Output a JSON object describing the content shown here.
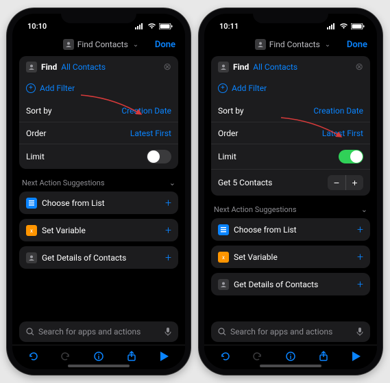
{
  "phones": [
    {
      "time": "10:10",
      "nav": {
        "title": "Find Contacts",
        "done": "Done"
      },
      "find": {
        "action": "Find",
        "target": "All Contacts",
        "add_filter": "Add Filter"
      },
      "sort": {
        "label": "Sort by",
        "value": "Creation Date"
      },
      "order": {
        "label": "Order",
        "value": "Latest First"
      },
      "limit": {
        "label": "Limit",
        "on": false
      },
      "get_row": null,
      "suggestions_header": "Next Action Suggestions",
      "suggestions": [
        {
          "label": "Choose from List",
          "icon": "blue"
        },
        {
          "label": "Set Variable",
          "icon": "orange"
        },
        {
          "label": "Get Details of Contacts",
          "icon": "gray"
        }
      ],
      "search_placeholder": "Search for apps and actions"
    },
    {
      "time": "10:11",
      "nav": {
        "title": "Find Contacts",
        "done": "Done"
      },
      "find": {
        "action": "Find",
        "target": "All Contacts",
        "add_filter": "Add Filter"
      },
      "sort": {
        "label": "Sort by",
        "value": "Creation Date"
      },
      "order": {
        "label": "Order",
        "value": "Latest First"
      },
      "limit": {
        "label": "Limit",
        "on": true
      },
      "get_row": {
        "label": "Get 5 Contacts"
      },
      "suggestions_header": "Next Action Suggestions",
      "suggestions": [
        {
          "label": "Choose from List",
          "icon": "blue"
        },
        {
          "label": "Set Variable",
          "icon": "orange"
        },
        {
          "label": "Get Details of Contacts",
          "icon": "gray"
        }
      ],
      "search_placeholder": "Search for apps and actions"
    }
  ],
  "colors": {
    "accent": "#0a84ff",
    "toggle_on": "#30d158"
  }
}
